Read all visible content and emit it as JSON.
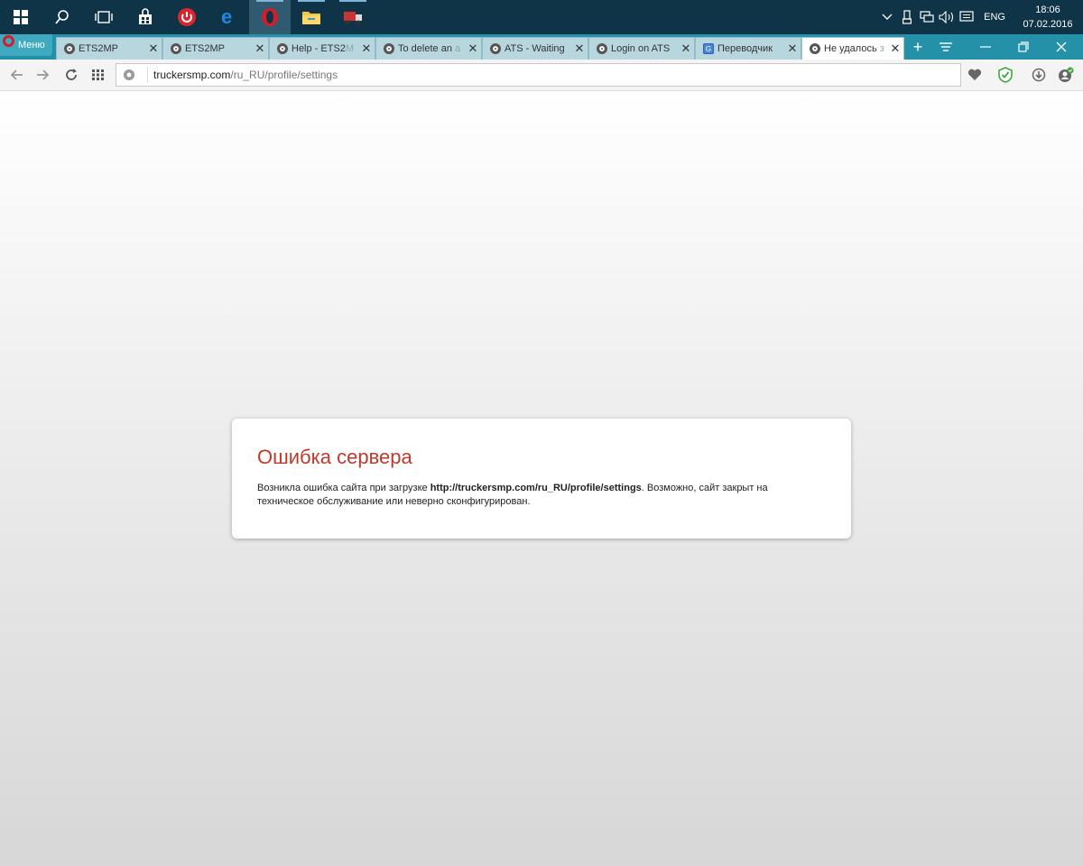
{
  "taskbar": {
    "tray": {
      "language": "ENG",
      "time": "18:06",
      "date": "07.02.2016"
    }
  },
  "browser": {
    "menu_label": "Меню",
    "tabs": [
      {
        "title": "ETS2MP",
        "fade": ""
      },
      {
        "title": "ETS2MP",
        "fade": ""
      },
      {
        "title": "Help - ETS2",
        "fade": "M"
      },
      {
        "title": "To delete an",
        "fade": " a"
      },
      {
        "title": "ATS - Waiting",
        "fade": ""
      },
      {
        "title": "Login on ATS",
        "fade": ""
      },
      {
        "title": "Переводчик",
        "fade": ""
      },
      {
        "title": "Не удалось",
        "fade": " з"
      }
    ],
    "url_host": "truckersmp.com",
    "url_path": "/ru_RU/profile/settings"
  },
  "error": {
    "title": "Ошибка сервера",
    "msg_before": "Возникла ошибка сайта при загрузке ",
    "msg_url": "http://truckersmp.com/ru_RU/profile/settings",
    "msg_after": ". Возможно, сайт закрыт на техническое обслуживание или неверно сконфигурирован."
  },
  "colors": {
    "accent": "#2591a8",
    "error_title": "#c0392b",
    "opera_red": "#d21e2a"
  }
}
